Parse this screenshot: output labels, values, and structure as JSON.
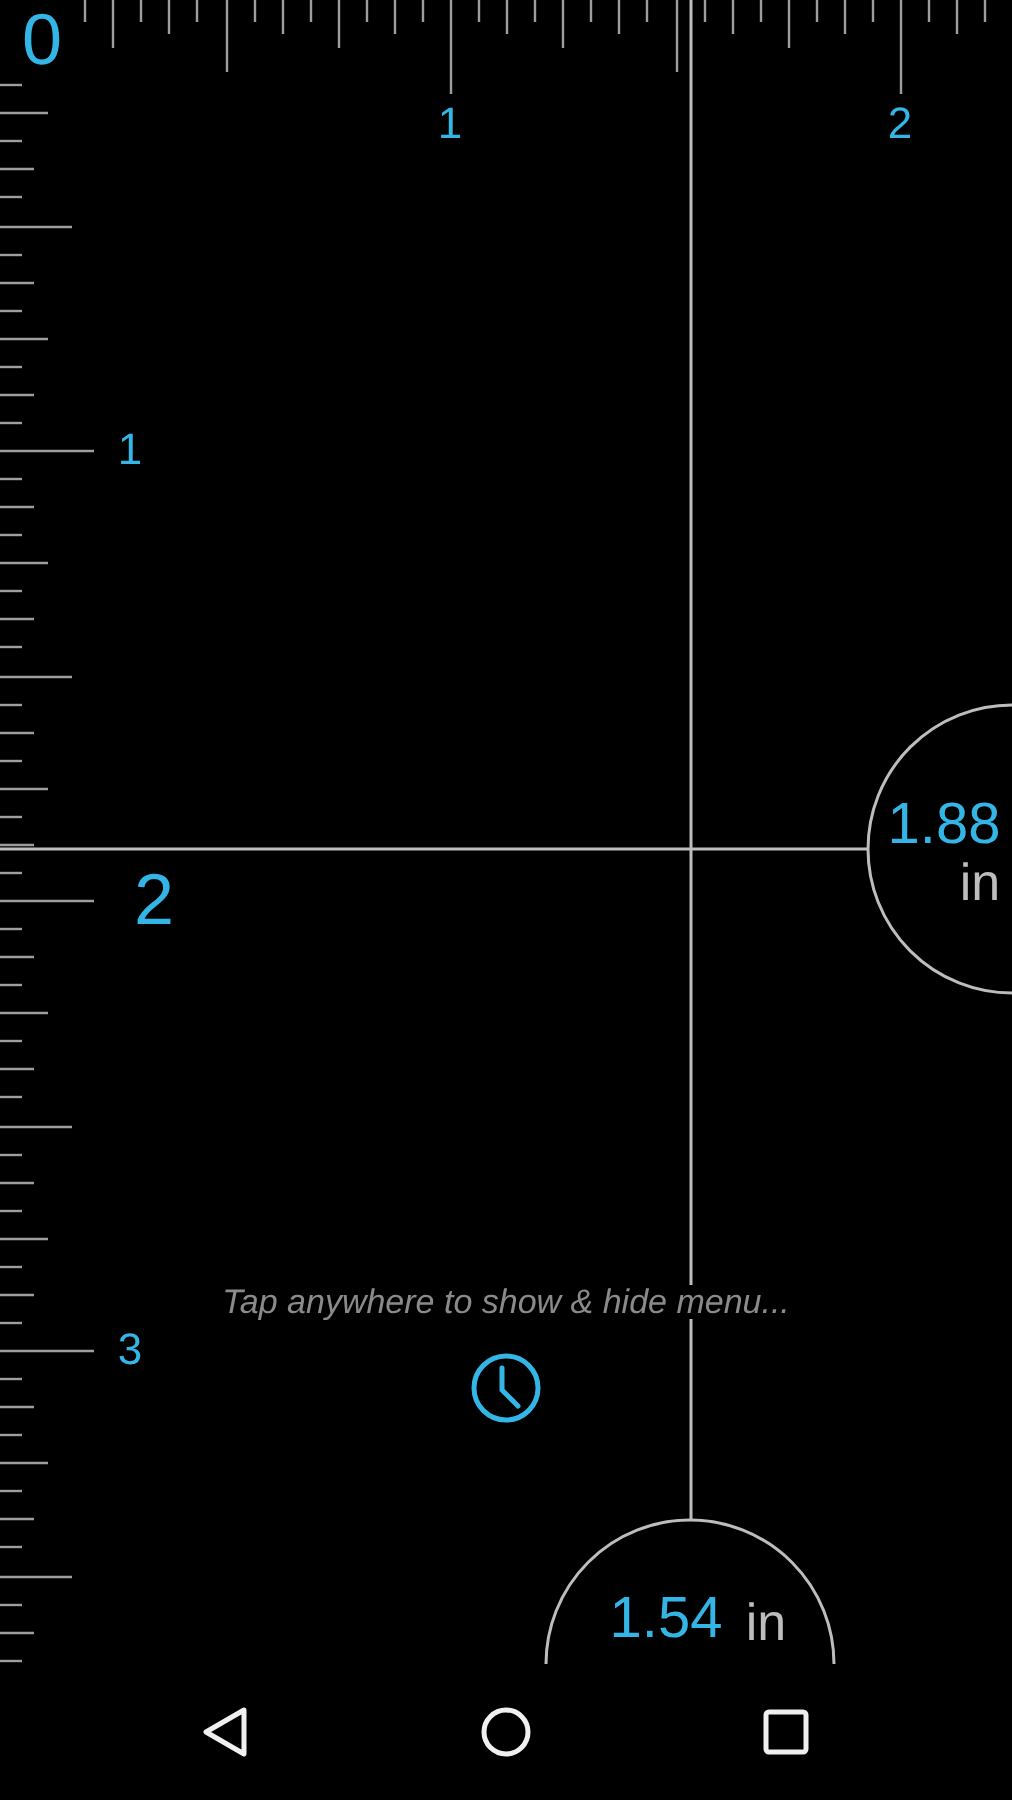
{
  "horizontal_ruler": {
    "labels": [
      {
        "text": "0",
        "emphasized": true
      },
      {
        "text": "1",
        "emphasized": false
      },
      {
        "text": "2",
        "emphasized": false
      }
    ]
  },
  "vertical_ruler": {
    "labels": [
      {
        "text": "1",
        "emphasized": false
      },
      {
        "text": "2",
        "emphasized": true
      },
      {
        "text": "3",
        "emphasized": false
      }
    ]
  },
  "readouts": [
    {
      "kind": "side",
      "value": "1.88",
      "unit": "in"
    },
    {
      "kind": "bottom",
      "value": "1.54",
      "unit": "in"
    }
  ],
  "hint": "Tap anywhere to show & hide menu...",
  "nav_bar": {
    "buttons": [
      {
        "kind": "back"
      },
      {
        "kind": "home"
      },
      {
        "kind": "recents"
      }
    ]
  }
}
